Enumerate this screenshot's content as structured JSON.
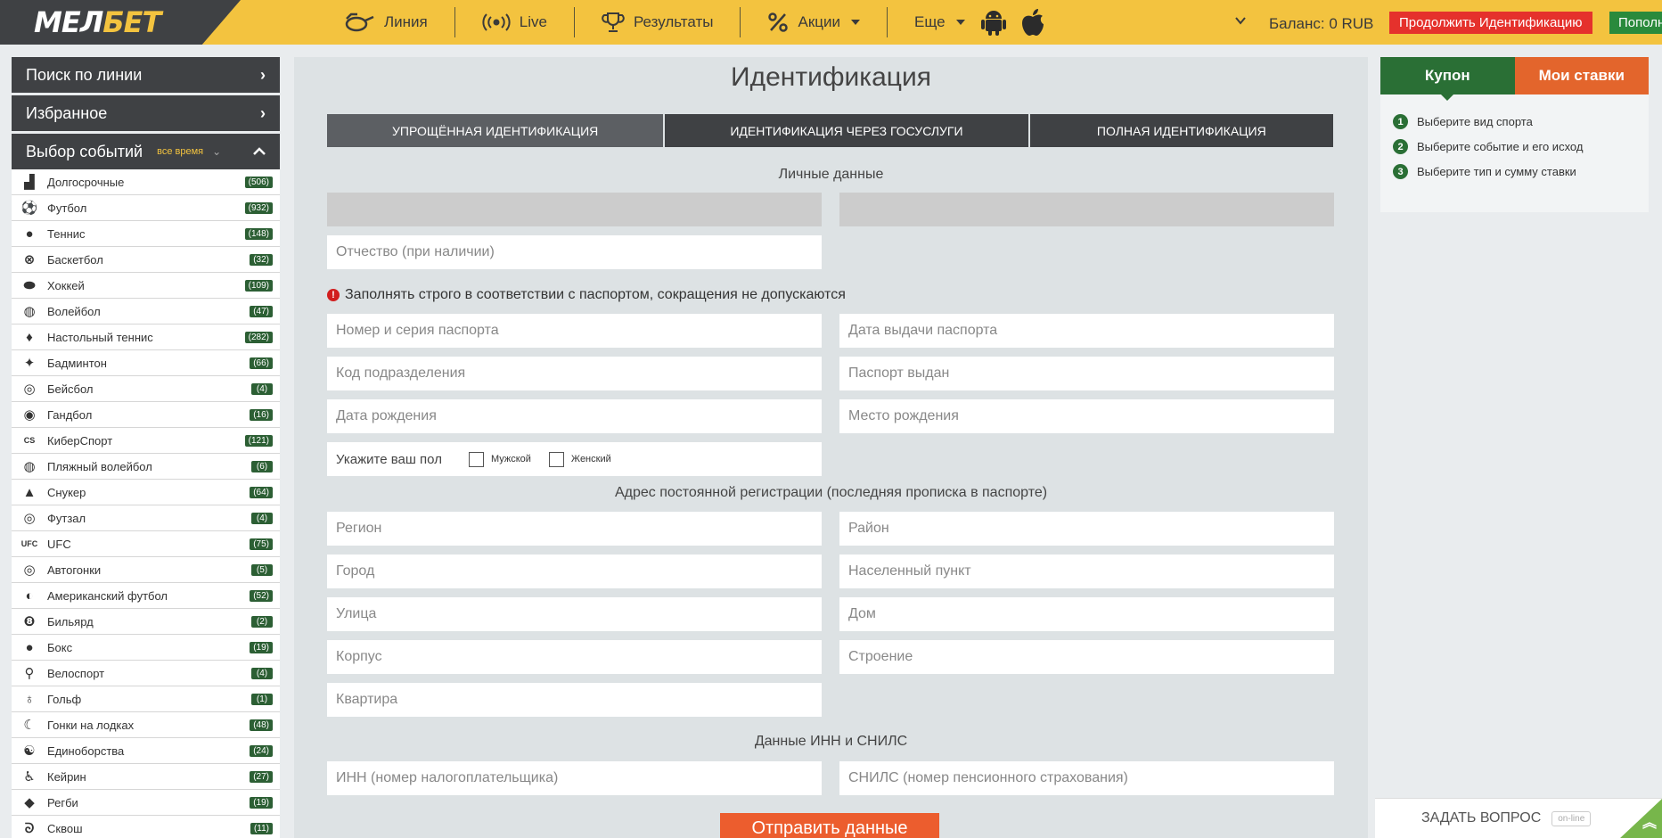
{
  "header": {
    "logo": "МЕЛБЕТ",
    "nav": [
      {
        "label": "Линия",
        "icon": "line-icon"
      },
      {
        "label": "Live",
        "icon": "live-icon"
      },
      {
        "label": "Результаты",
        "icon": "trophy-icon"
      },
      {
        "label": "Акции",
        "icon": "percent-icon"
      },
      {
        "label": "Еще",
        "icon": ""
      }
    ],
    "balance": "Баланс: 0 RUB",
    "continue_button": "Продолжить Идентификацию",
    "deposit_button": "Пополнить",
    "colors": {
      "bar": "#f3c33f",
      "dark": "#3f4144",
      "red": "#e5312c",
      "green": "#2a8a3c"
    }
  },
  "sidebar": {
    "search_line": "Поиск по линии",
    "favorites": "Избранное",
    "events_choice": "Выбор событий",
    "all_time": "все время",
    "sports": [
      {
        "name": "Долгосрочные",
        "count": "(506)"
      },
      {
        "name": "Футбол",
        "count": "(932)"
      },
      {
        "name": "Теннис",
        "count": "(148)"
      },
      {
        "name": "Баскетбол",
        "count": "(32)"
      },
      {
        "name": "Хоккей",
        "count": "(109)"
      },
      {
        "name": "Волейбол",
        "count": "(47)"
      },
      {
        "name": "Настольный теннис",
        "count": "(282)"
      },
      {
        "name": "Бадминтон",
        "count": "(66)"
      },
      {
        "name": "Бейсбол",
        "count": "(4)"
      },
      {
        "name": "Гандбол",
        "count": "(16)"
      },
      {
        "name": "КиберСпорт",
        "count": "(121)"
      },
      {
        "name": "Пляжный волейбол",
        "count": "(6)"
      },
      {
        "name": "Снукер",
        "count": "(64)"
      },
      {
        "name": "Футзал",
        "count": "(4)"
      },
      {
        "name": "UFC",
        "count": "(75)"
      },
      {
        "name": "Автогонки",
        "count": "(5)"
      },
      {
        "name": "Американский футбол",
        "count": "(52)"
      },
      {
        "name": "Бильярд",
        "count": "(2)"
      },
      {
        "name": "Бокс",
        "count": "(19)"
      },
      {
        "name": "Велоспорт",
        "count": "(4)"
      },
      {
        "name": "Гольф",
        "count": "(1)"
      },
      {
        "name": "Гонки на лодках",
        "count": "(48)"
      },
      {
        "name": "Единоборства",
        "count": "(24)"
      },
      {
        "name": "Кейрин",
        "count": "(27)"
      },
      {
        "name": "Регби",
        "count": "(19)"
      },
      {
        "name": "Сквош",
        "count": "(11)"
      }
    ]
  },
  "main": {
    "title": "Идентификация",
    "tabs": [
      {
        "label": "Упрощённая идентификация"
      },
      {
        "label": "Идентификация через Госуслуги"
      },
      {
        "label": "Полная идентификация"
      }
    ],
    "personal_data": "Личные данные",
    "patronymic_placeholder": "Отчество (при наличии)",
    "warning": "Заполнять строго в соответствии с паспортом, сокращения не допускаются",
    "passport_number": "Номер и серия паспорта",
    "passport_date": "Дата выдачи паспорта",
    "division_code": "Код подразделения",
    "passport_issued": "Паспорт выдан",
    "birth_date": "Дата рождения",
    "birth_place": "Место рождения",
    "gender_label": "Укажите ваш пол",
    "gender_male": "Мужской",
    "gender_female": "Женский",
    "address_title": "Адрес постоянной регистрации (последняя прописка в паспорте)",
    "region": "Регион",
    "district": "Район",
    "city": "Город",
    "settlement": "Населенный пункт",
    "street": "Улица",
    "house": "Дом",
    "korpus": "Корпус",
    "building": "Строение",
    "apartment": "Квартира",
    "inn_title": "Данные ИНН и СНИЛС",
    "inn": "ИНН (номер налогоплательщика)",
    "snils": "СНИЛС (номер пенсионного страхования)",
    "submit": "Отправить данные"
  },
  "coupon": {
    "tab_coupon": "Купон",
    "tab_bets": "Мои ставки",
    "steps": [
      {
        "num": "1",
        "text": "Выберите вид спорта"
      },
      {
        "num": "2",
        "text": "Выберите событие и его исход"
      },
      {
        "num": "3",
        "text": "Выберите тип и сумму ставки"
      }
    ]
  },
  "ask": {
    "label": "ЗАДАТЬ ВОПРОС",
    "status": "on-line"
  }
}
